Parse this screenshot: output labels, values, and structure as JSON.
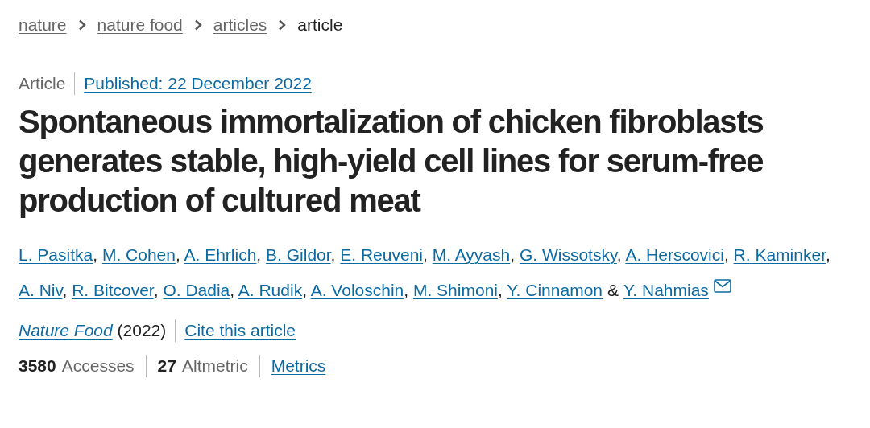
{
  "breadcrumbs": [
    {
      "label": "nature",
      "current": false
    },
    {
      "label": "nature food",
      "current": false
    },
    {
      "label": "articles",
      "current": false
    },
    {
      "label": "article",
      "current": true
    }
  ],
  "article_type": "Article",
  "published": "Published: 22 December 2022",
  "title": "Spontaneous immortalization of chicken fibroblasts generates stable, high-yield cell lines for serum-free production of cultured meat",
  "authors": [
    {
      "name": "L. Pasitka",
      "after": ","
    },
    {
      "name": "M. Cohen",
      "after": ","
    },
    {
      "name": "A. Ehrlich",
      "after": ","
    },
    {
      "name": "B. Gildor",
      "after": ","
    },
    {
      "name": "E. Reuveni",
      "after": ","
    },
    {
      "name": "M. Ayyash",
      "after": ","
    },
    {
      "name": "G. Wissotsky",
      "after": ","
    },
    {
      "name": "A. Herscovici",
      "after": ","
    },
    {
      "name": "R. Kaminker",
      "after": ","
    },
    {
      "name": "A. Niv",
      "after": ","
    },
    {
      "name": "R. Bitcover",
      "after": ","
    },
    {
      "name": "O. Dadia",
      "after": ","
    },
    {
      "name": "A. Rudik",
      "after": ","
    },
    {
      "name": "A. Voloschin",
      "after": ","
    },
    {
      "name": "M. Shimoni",
      "after": ","
    },
    {
      "name": "Y. Cinnamon",
      "after": "&"
    },
    {
      "name": "Y. Nahmias",
      "email": true
    }
  ],
  "journal": {
    "name": "Nature Food",
    "year": "(2022)",
    "cite": "Cite this article"
  },
  "metrics": {
    "items": [
      {
        "count": "3580",
        "unit": "Accesses"
      },
      {
        "count": "27",
        "unit": "Altmetric"
      }
    ],
    "link": "Metrics"
  }
}
